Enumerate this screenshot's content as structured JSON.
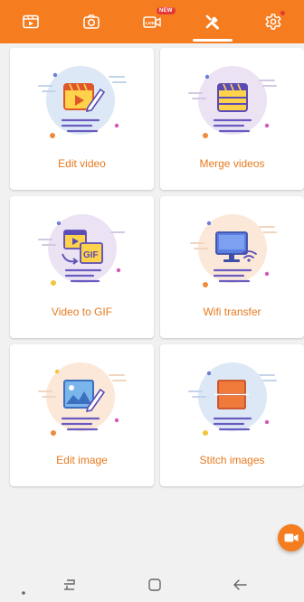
{
  "tabs": [
    {
      "icon": "video-editor-icon",
      "active": false
    },
    {
      "icon": "camera-icon",
      "active": false
    },
    {
      "icon": "live-stream-icon",
      "active": false,
      "badge": "NEW"
    },
    {
      "icon": "tools-icon",
      "active": true
    },
    {
      "icon": "settings-icon",
      "active": false
    }
  ],
  "tools": [
    {
      "label": "Edit video",
      "icon": "edit-video-icon",
      "circle_color": "#dce8f5"
    },
    {
      "label": "Merge videos",
      "icon": "merge-videos-icon",
      "circle_color": "#ebe3f3"
    },
    {
      "label": "Video to GIF",
      "icon": "video-to-gif-icon",
      "circle_color": "#ebe3f3",
      "gif_text": "GIF"
    },
    {
      "label": "Wifi transfer",
      "icon": "wifi-transfer-icon",
      "circle_color": "#fbe8d8"
    },
    {
      "label": "Edit image",
      "icon": "edit-image-icon",
      "circle_color": "#fbe8d8"
    },
    {
      "label": "Stitch images",
      "icon": "stitch-images-icon",
      "circle_color": "#dce8f5"
    }
  ],
  "colors": {
    "accent": "#f57c1f",
    "label": "#e8791e",
    "background": "#f1f1f1",
    "card": "#ffffff",
    "badge": "#e53935"
  }
}
